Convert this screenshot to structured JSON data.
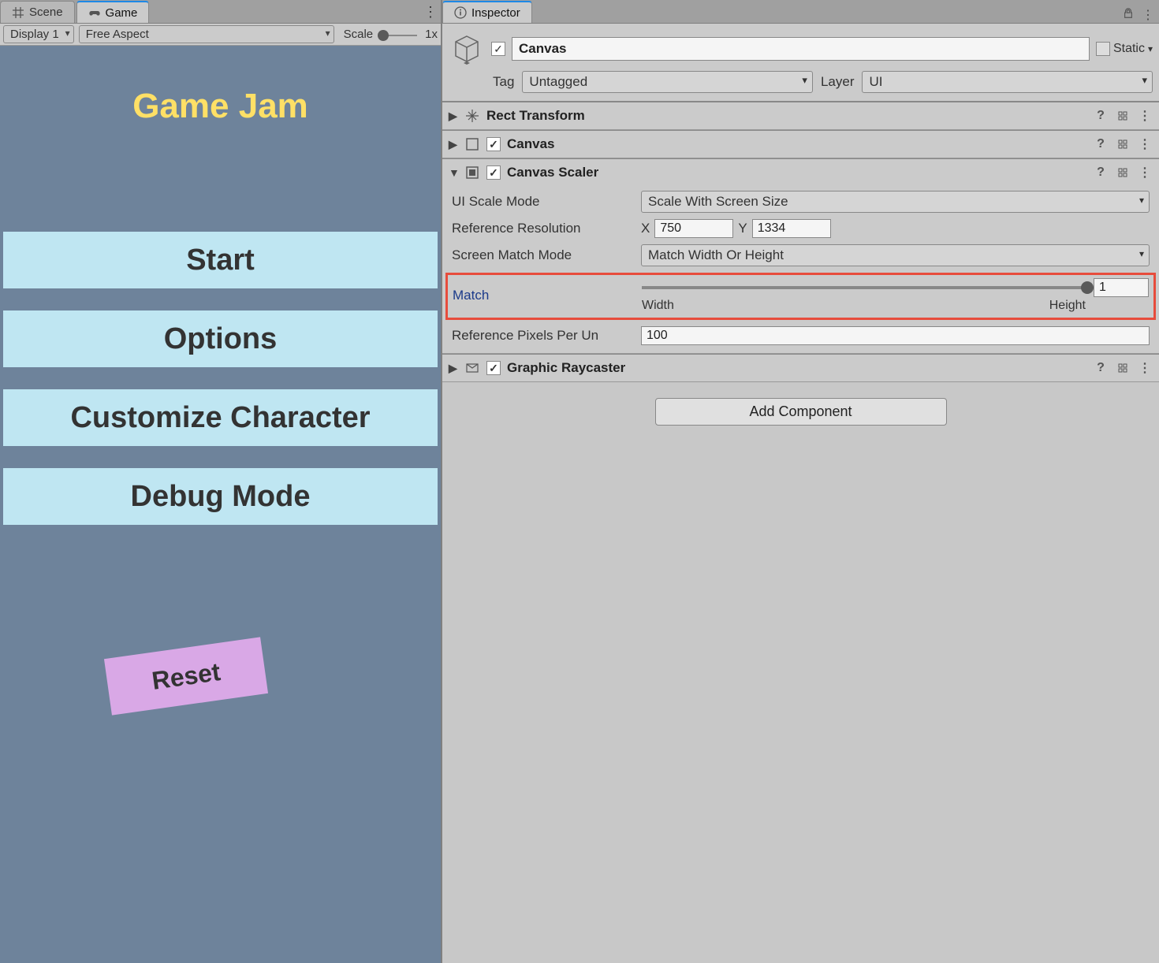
{
  "left": {
    "tabs": {
      "scene": "Scene",
      "game": "Game"
    },
    "toolbar": {
      "display": "Display 1",
      "aspect": "Free Aspect",
      "scale_label": "Scale",
      "scale_value": "1x"
    },
    "game": {
      "title": "Game Jam",
      "btn_start": "Start",
      "btn_options": "Options",
      "btn_customize": "Customize Character",
      "btn_debug": "Debug Mode",
      "btn_reset": "Reset"
    }
  },
  "inspector": {
    "tab": "Inspector",
    "object_name": "Canvas",
    "static_label": "Static",
    "tag_label": "Tag",
    "tag_value": "Untagged",
    "layer_label": "Layer",
    "layer_value": "UI",
    "components": {
      "rect": {
        "title": "Rect Transform"
      },
      "canvas": {
        "title": "Canvas"
      },
      "scaler": {
        "title": "Canvas Scaler",
        "mode_label": "UI Scale Mode",
        "mode_value": "Scale With Screen Size",
        "refres_label": "Reference Resolution",
        "ref_x": "750",
        "ref_y": "1334",
        "matchmode_label": "Screen Match Mode",
        "matchmode_value": "Match Width Or Height",
        "match_label": "Match",
        "match_value": "1",
        "match_width": "Width",
        "match_height": "Height",
        "ppu_label": "Reference Pixels Per Un",
        "ppu_value": "100"
      },
      "raycaster": {
        "title": "Graphic Raycaster"
      }
    },
    "add_component": "Add Component"
  }
}
